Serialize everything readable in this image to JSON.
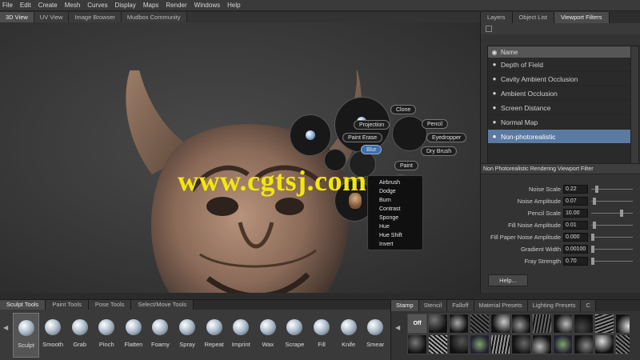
{
  "menu": [
    "File",
    "Edit",
    "Create",
    "Mesh",
    "Curves",
    "Display",
    "Maps",
    "Render",
    "Windows",
    "Help"
  ],
  "viewport_tabs": [
    {
      "label": "3D View",
      "active": true
    },
    {
      "label": "UV View",
      "active": false
    },
    {
      "label": "Image Browser",
      "active": false
    },
    {
      "label": "Mudbox Community",
      "active": false
    }
  ],
  "marking_menu": {
    "labels": {
      "clone": "Clone",
      "projection": "Projection",
      "pencil": "Pencil",
      "paint_erase": "Paint Erase",
      "eyedropper": "Eyedropper",
      "blur": "Blur",
      "dry_brush": "Dry Brush",
      "paint": "Paint"
    },
    "submenu": [
      "Airbrush",
      "Dodge",
      "Burn",
      "Contrast",
      "Sponge",
      "Hue",
      "Hue Shift",
      "Invert"
    ]
  },
  "watermark": "www.cgtsj.com",
  "right_panel": {
    "tabs": [
      {
        "label": "Layers",
        "active": false
      },
      {
        "label": "Object List",
        "active": false
      },
      {
        "label": "Viewport Filters",
        "active": true
      }
    ],
    "list_header": "Name",
    "filters": [
      {
        "name": "Depth of Field",
        "selected": false
      },
      {
        "name": "Cavity Ambient Occlusion",
        "selected": false
      },
      {
        "name": "Ambient Occlusion",
        "selected": false
      },
      {
        "name": "Screen Distance",
        "selected": false
      },
      {
        "name": "Normal Map",
        "selected": false
      },
      {
        "name": "Non-photorealistic",
        "selected": true
      }
    ],
    "properties_title": "Non Photorealistic Rendering Viewport Filter",
    "properties": [
      {
        "label": "Noise Scale",
        "value": "0.22",
        "knob": 0.1
      },
      {
        "label": "Noise Amplitude",
        "value": "0.07",
        "knob": 0.05
      },
      {
        "label": "Pencil Scale",
        "value": "10.00",
        "knob": 0.75
      },
      {
        "label": "Fill Noise Amplitude",
        "value": "0.01",
        "knob": 0.04
      },
      {
        "label": "Fill Paper Noise Amplitude",
        "value": "0.000",
        "knob": 0.0
      },
      {
        "label": "Gradient Width",
        "value": "0.00100",
        "knob": 0.0
      },
      {
        "label": "Fray Strength",
        "value": "0.70",
        "knob": 0.0
      }
    ],
    "help_label": "Help..."
  },
  "shelf": {
    "tabs": [
      {
        "label": "Sculpt Tools",
        "active": true
      },
      {
        "label": "Paint Tools",
        "active": false
      },
      {
        "label": "Pose Tools",
        "active": false
      },
      {
        "label": "Select/Move Tools",
        "active": false
      }
    ],
    "tools": [
      {
        "name": "Sculpt",
        "active": true
      },
      {
        "name": "Smooth",
        "active": false
      },
      {
        "name": "Grab",
        "active": false
      },
      {
        "name": "Pinch",
        "active": false
      },
      {
        "name": "Flatten",
        "active": false
      },
      {
        "name": "Foamy",
        "active": false
      },
      {
        "name": "Spray",
        "active": false
      },
      {
        "name": "Repeat",
        "active": false
      },
      {
        "name": "Imprint",
        "active": false
      },
      {
        "name": "Wax",
        "active": false
      },
      {
        "name": "Scrape",
        "active": false
      },
      {
        "name": "Fill",
        "active": false
      },
      {
        "name": "Knife",
        "active": false
      },
      {
        "name": "Smear",
        "active": false
      }
    ]
  },
  "stamp_panel": {
    "tabs": [
      {
        "label": "Stamp",
        "active": true
      },
      {
        "label": "Stencil",
        "active": false
      },
      {
        "label": "Falloff",
        "active": false
      },
      {
        "label": "Material Presets",
        "active": false
      },
      {
        "label": "Lighting Presets",
        "active": false
      },
      {
        "label": "C",
        "active": false
      }
    ],
    "off_label": "Off"
  },
  "colors": {
    "selection_blue": "#5a7aa3",
    "watermark_yellow": "#f2e80a",
    "marking_menu_highlight": "#3d6fb0"
  }
}
